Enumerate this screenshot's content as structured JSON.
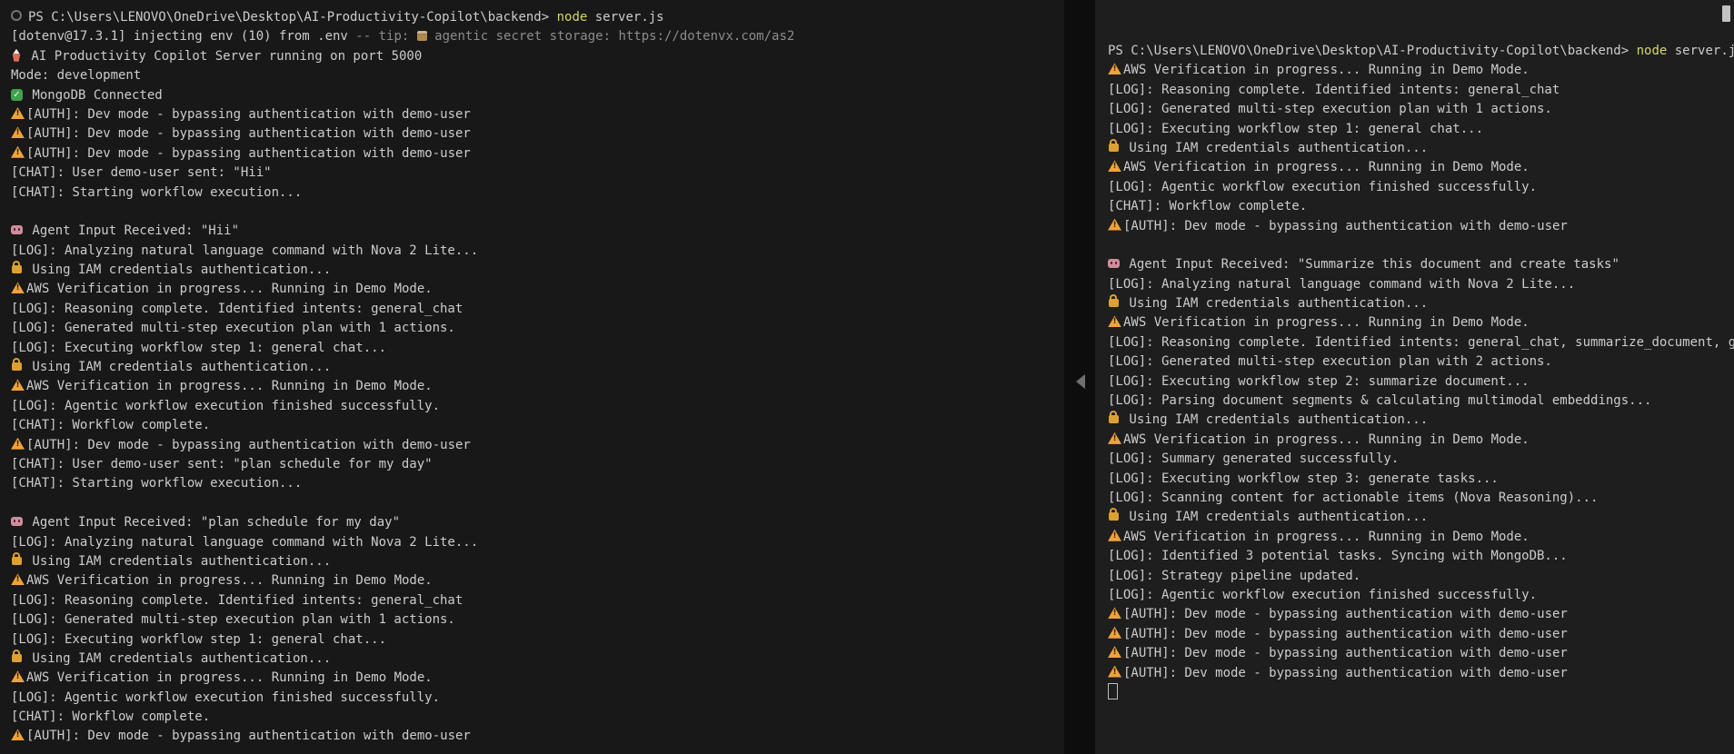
{
  "colors": {
    "bg-left": "#181818",
    "bg-right": "#1e1e1e",
    "fg": "#cccccc",
    "cmd": "#d6d66a",
    "dim": "#8c8c8c",
    "warning": "#f0a33c",
    "lock": "#dda032",
    "check": "#3fa34d",
    "robot": "#cf8d9b",
    "rocket": "#de6a5a",
    "package": "#b08950"
  },
  "icons": {
    "circle": "prompt-command-decoration",
    "warning": "warning-triangle",
    "lock": "padlock",
    "robot": "robot-agent",
    "rocket": "rocket-launch",
    "check": "green-checkmark",
    "package": "package-box",
    "cursor": "terminal-block-cursor"
  },
  "terminal": {
    "left_pane": {
      "lines": [
        {
          "parts": [
            {
              "i": "circle"
            },
            {
              "t": "PS C:\\Users\\LENOVO\\OneDrive\\Desktop\\AI-Productivity-Copilot\\backend> ",
              "c": "fg"
            },
            {
              "t": "node",
              "c": "cmd"
            },
            {
              "t": " server.js",
              "c": "fg"
            }
          ]
        },
        {
          "parts": [
            {
              "t": "[dotenv@17.3.1] injecting env (10) from .env ",
              "c": "fg"
            },
            {
              "t": "-- tip: ",
              "c": "dim"
            },
            {
              "i": "package"
            },
            {
              "t": " agentic secret storage: ",
              "c": "dim"
            },
            {
              "t": "https://dotenvx.com/as2",
              "c": "link"
            }
          ]
        },
        {
          "parts": [
            {
              "i": "rocket"
            },
            {
              "t": " AI Productivity Copilot Server running on port 5000",
              "c": "fg"
            }
          ]
        },
        {
          "parts": [
            {
              "t": "Mode: development",
              "c": "fg"
            }
          ]
        },
        {
          "parts": [
            {
              "i": "check"
            },
            {
              "t": " MongoDB Connected",
              "c": "fg"
            }
          ]
        },
        {
          "parts": [
            {
              "i": "warning"
            },
            {
              "t": "[AUTH]: Dev mode - bypassing authentication with demo-user",
              "c": "fg"
            }
          ]
        },
        {
          "parts": [
            {
              "i": "warning"
            },
            {
              "t": "[AUTH]: Dev mode - bypassing authentication with demo-user",
              "c": "fg"
            }
          ]
        },
        {
          "parts": [
            {
              "i": "warning"
            },
            {
              "t": "[AUTH]: Dev mode - bypassing authentication with demo-user",
              "c": "fg"
            }
          ]
        },
        {
          "parts": [
            {
              "t": "[CHAT]: User demo-user sent: \"Hii\"",
              "c": "fg"
            }
          ]
        },
        {
          "parts": [
            {
              "t": "[CHAT]: Starting workflow execution...",
              "c": "fg"
            }
          ]
        },
        {
          "parts": []
        },
        {
          "parts": [
            {
              "i": "robot"
            },
            {
              "t": " Agent Input Received: \"Hii\"",
              "c": "fg"
            }
          ]
        },
        {
          "parts": [
            {
              "t": "[LOG]: Analyzing natural language command with Nova 2 Lite...",
              "c": "fg"
            }
          ]
        },
        {
          "parts": [
            {
              "i": "lock"
            },
            {
              "t": " Using IAM credentials authentication...",
              "c": "fg"
            }
          ]
        },
        {
          "parts": [
            {
              "i": "warning"
            },
            {
              "t": "AWS Verification in progress... Running in Demo Mode.",
              "c": "fg"
            }
          ]
        },
        {
          "parts": [
            {
              "t": "[LOG]: Reasoning complete. Identified intents: general_chat",
              "c": "fg"
            }
          ]
        },
        {
          "parts": [
            {
              "t": "[LOG]: Generated multi-step execution plan with 1 actions.",
              "c": "fg"
            }
          ]
        },
        {
          "parts": [
            {
              "t": "[LOG]: Executing workflow step 1: general chat...",
              "c": "fg"
            }
          ]
        },
        {
          "parts": [
            {
              "i": "lock"
            },
            {
              "t": " Using IAM credentials authentication...",
              "c": "fg"
            }
          ]
        },
        {
          "parts": [
            {
              "i": "warning"
            },
            {
              "t": "AWS Verification in progress... Running in Demo Mode.",
              "c": "fg"
            }
          ]
        },
        {
          "parts": [
            {
              "t": "[LOG]: Agentic workflow execution finished successfully.",
              "c": "fg"
            }
          ]
        },
        {
          "parts": [
            {
              "t": "[CHAT]: Workflow complete.",
              "c": "fg"
            }
          ]
        },
        {
          "parts": [
            {
              "i": "warning"
            },
            {
              "t": "[AUTH]: Dev mode - bypassing authentication with demo-user",
              "c": "fg"
            }
          ]
        },
        {
          "parts": [
            {
              "t": "[CHAT]: User demo-user sent: \"plan schedule for my day\"",
              "c": "fg"
            }
          ]
        },
        {
          "parts": [
            {
              "t": "[CHAT]: Starting workflow execution...",
              "c": "fg"
            }
          ]
        },
        {
          "parts": []
        },
        {
          "parts": [
            {
              "i": "robot"
            },
            {
              "t": " Agent Input Received: \"plan schedule for my day\"",
              "c": "fg"
            }
          ]
        },
        {
          "parts": [
            {
              "t": "[LOG]: Analyzing natural language command with Nova 2 Lite...",
              "c": "fg"
            }
          ]
        },
        {
          "parts": [
            {
              "i": "lock"
            },
            {
              "t": " Using IAM credentials authentication...",
              "c": "fg"
            }
          ]
        },
        {
          "parts": [
            {
              "i": "warning"
            },
            {
              "t": "AWS Verification in progress... Running in Demo Mode.",
              "c": "fg"
            }
          ]
        },
        {
          "parts": [
            {
              "t": "[LOG]: Reasoning complete. Identified intents: general_chat",
              "c": "fg"
            }
          ]
        },
        {
          "parts": [
            {
              "t": "[LOG]: Generated multi-step execution plan with 1 actions.",
              "c": "fg"
            }
          ]
        },
        {
          "parts": [
            {
              "t": "[LOG]: Executing workflow step 1: general chat...",
              "c": "fg"
            }
          ]
        },
        {
          "parts": [
            {
              "i": "lock"
            },
            {
              "t": " Using IAM credentials authentication...",
              "c": "fg"
            }
          ]
        },
        {
          "parts": [
            {
              "i": "warning"
            },
            {
              "t": "AWS Verification in progress... Running in Demo Mode.",
              "c": "fg"
            }
          ]
        },
        {
          "parts": [
            {
              "t": "[LOG]: Agentic workflow execution finished successfully.",
              "c": "fg"
            }
          ]
        },
        {
          "parts": [
            {
              "t": "[CHAT]: Workflow complete.",
              "c": "fg"
            }
          ]
        },
        {
          "parts": [
            {
              "i": "warning"
            },
            {
              "t": "[AUTH]: Dev mode - bypassing authentication with demo-user",
              "c": "fg"
            }
          ]
        }
      ]
    },
    "right_pane": {
      "lines": [
        {
          "parts": [
            {
              "t": "PS C:\\Users\\LENOVO\\OneDrive\\Desktop\\AI-Productivity-Copilot\\backend> ",
              "c": "fg"
            },
            {
              "t": "node",
              "c": "cmd"
            },
            {
              "t": " server.js",
              "c": "fg"
            }
          ]
        },
        {
          "parts": [
            {
              "i": "warning"
            },
            {
              "t": "AWS Verification in progress... Running in Demo Mode.",
              "c": "fg"
            }
          ]
        },
        {
          "parts": [
            {
              "t": "[LOG]: Reasoning complete. Identified intents: general_chat",
              "c": "fg"
            }
          ]
        },
        {
          "parts": [
            {
              "t": "[LOG]: Generated multi-step execution plan with 1 actions.",
              "c": "fg"
            }
          ]
        },
        {
          "parts": [
            {
              "t": "[LOG]: Executing workflow step 1: general chat...",
              "c": "fg"
            }
          ]
        },
        {
          "parts": [
            {
              "i": "lock"
            },
            {
              "t": " Using IAM credentials authentication...",
              "c": "fg"
            }
          ]
        },
        {
          "parts": [
            {
              "i": "warning"
            },
            {
              "t": "AWS Verification in progress... Running in Demo Mode.",
              "c": "fg"
            }
          ]
        },
        {
          "parts": [
            {
              "t": "[LOG]: Agentic workflow execution finished successfully.",
              "c": "fg"
            }
          ]
        },
        {
          "parts": [
            {
              "t": "[CHAT]: Workflow complete.",
              "c": "fg"
            }
          ]
        },
        {
          "parts": [
            {
              "i": "warning"
            },
            {
              "t": "[AUTH]: Dev mode - bypassing authentication with demo-user",
              "c": "fg"
            }
          ]
        },
        {
          "parts": []
        },
        {
          "parts": [
            {
              "i": "robot"
            },
            {
              "t": " Agent Input Received: \"Summarize this document and create tasks\"",
              "c": "fg"
            }
          ]
        },
        {
          "parts": [
            {
              "t": "[LOG]: Analyzing natural language command with Nova 2 Lite...",
              "c": "fg"
            }
          ]
        },
        {
          "parts": [
            {
              "i": "lock"
            },
            {
              "t": " Using IAM credentials authentication...",
              "c": "fg"
            }
          ]
        },
        {
          "parts": [
            {
              "i": "warning"
            },
            {
              "t": "AWS Verification in progress... Running in Demo Mode.",
              "c": "fg"
            }
          ]
        },
        {
          "parts": [
            {
              "t": "[LOG]: Reasoning complete. Identified intents: general_chat, summarize_document, generate_tasks",
              "c": "fg"
            }
          ]
        },
        {
          "parts": [
            {
              "t": "[LOG]: Generated multi-step execution plan with 2 actions.",
              "c": "fg"
            }
          ]
        },
        {
          "parts": [
            {
              "t": "[LOG]: Executing workflow step 2: summarize document...",
              "c": "fg"
            }
          ]
        },
        {
          "parts": [
            {
              "t": "[LOG]: Parsing document segments & calculating multimodal embeddings...",
              "c": "fg"
            }
          ]
        },
        {
          "parts": [
            {
              "i": "lock"
            },
            {
              "t": " Using IAM credentials authentication...",
              "c": "fg"
            }
          ]
        },
        {
          "parts": [
            {
              "i": "warning"
            },
            {
              "t": "AWS Verification in progress... Running in Demo Mode.",
              "c": "fg"
            }
          ]
        },
        {
          "parts": [
            {
              "t": "[LOG]: Summary generated successfully.",
              "c": "fg"
            }
          ]
        },
        {
          "parts": [
            {
              "t": "[LOG]: Executing workflow step 3: generate tasks...",
              "c": "fg"
            }
          ]
        },
        {
          "parts": [
            {
              "t": "[LOG]: Scanning content for actionable items (Nova Reasoning)...",
              "c": "fg"
            }
          ]
        },
        {
          "parts": [
            {
              "i": "lock"
            },
            {
              "t": " Using IAM credentials authentication...",
              "c": "fg"
            }
          ]
        },
        {
          "parts": [
            {
              "i": "warning"
            },
            {
              "t": "AWS Verification in progress... Running in Demo Mode.",
              "c": "fg"
            }
          ]
        },
        {
          "parts": [
            {
              "t": "[LOG]: Identified 3 potential tasks. Syncing with MongoDB...",
              "c": "fg"
            }
          ]
        },
        {
          "parts": [
            {
              "t": "[LOG]: Strategy pipeline updated.",
              "c": "fg"
            }
          ]
        },
        {
          "parts": [
            {
              "t": "[LOG]: Agentic workflow execution finished successfully.",
              "c": "fg"
            }
          ]
        },
        {
          "parts": [
            {
              "i": "warning"
            },
            {
              "t": "[AUTH]: Dev mode - bypassing authentication with demo-user",
              "c": "fg"
            }
          ]
        },
        {
          "parts": [
            {
              "i": "warning"
            },
            {
              "t": "[AUTH]: Dev mode - bypassing authentication with demo-user",
              "c": "fg"
            }
          ]
        },
        {
          "parts": [
            {
              "i": "warning"
            },
            {
              "t": "[AUTH]: Dev mode - bypassing authentication with demo-user",
              "c": "fg"
            }
          ]
        },
        {
          "parts": [
            {
              "i": "warning"
            },
            {
              "t": "[AUTH]: Dev mode - bypassing authentication with demo-user",
              "c": "fg"
            }
          ]
        },
        {
          "parts": [
            {
              "i": "cursor"
            }
          ]
        }
      ]
    }
  }
}
